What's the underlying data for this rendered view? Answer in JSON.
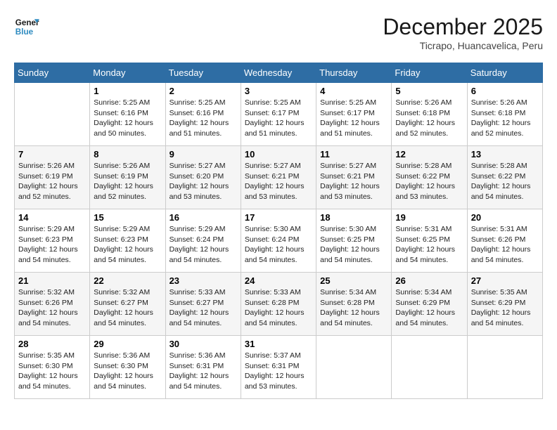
{
  "logo": {
    "line1": "General",
    "line2": "Blue"
  },
  "title": "December 2025",
  "location": "Ticrapo, Huancavelica, Peru",
  "days_header": [
    "Sunday",
    "Monday",
    "Tuesday",
    "Wednesday",
    "Thursday",
    "Friday",
    "Saturday"
  ],
  "weeks": [
    [
      {
        "day": "",
        "sunrise": "",
        "sunset": "",
        "daylight": ""
      },
      {
        "day": "1",
        "sunrise": "Sunrise: 5:25 AM",
        "sunset": "Sunset: 6:16 PM",
        "daylight": "Daylight: 12 hours and 50 minutes."
      },
      {
        "day": "2",
        "sunrise": "Sunrise: 5:25 AM",
        "sunset": "Sunset: 6:16 PM",
        "daylight": "Daylight: 12 hours and 51 minutes."
      },
      {
        "day": "3",
        "sunrise": "Sunrise: 5:25 AM",
        "sunset": "Sunset: 6:17 PM",
        "daylight": "Daylight: 12 hours and 51 minutes."
      },
      {
        "day": "4",
        "sunrise": "Sunrise: 5:25 AM",
        "sunset": "Sunset: 6:17 PM",
        "daylight": "Daylight: 12 hours and 51 minutes."
      },
      {
        "day": "5",
        "sunrise": "Sunrise: 5:26 AM",
        "sunset": "Sunset: 6:18 PM",
        "daylight": "Daylight: 12 hours and 52 minutes."
      },
      {
        "day": "6",
        "sunrise": "Sunrise: 5:26 AM",
        "sunset": "Sunset: 6:18 PM",
        "daylight": "Daylight: 12 hours and 52 minutes."
      }
    ],
    [
      {
        "day": "7",
        "sunrise": "Sunrise: 5:26 AM",
        "sunset": "Sunset: 6:19 PM",
        "daylight": "Daylight: 12 hours and 52 minutes."
      },
      {
        "day": "8",
        "sunrise": "Sunrise: 5:26 AM",
        "sunset": "Sunset: 6:19 PM",
        "daylight": "Daylight: 12 hours and 52 minutes."
      },
      {
        "day": "9",
        "sunrise": "Sunrise: 5:27 AM",
        "sunset": "Sunset: 6:20 PM",
        "daylight": "Daylight: 12 hours and 53 minutes."
      },
      {
        "day": "10",
        "sunrise": "Sunrise: 5:27 AM",
        "sunset": "Sunset: 6:21 PM",
        "daylight": "Daylight: 12 hours and 53 minutes."
      },
      {
        "day": "11",
        "sunrise": "Sunrise: 5:27 AM",
        "sunset": "Sunset: 6:21 PM",
        "daylight": "Daylight: 12 hours and 53 minutes."
      },
      {
        "day": "12",
        "sunrise": "Sunrise: 5:28 AM",
        "sunset": "Sunset: 6:22 PM",
        "daylight": "Daylight: 12 hours and 53 minutes."
      },
      {
        "day": "13",
        "sunrise": "Sunrise: 5:28 AM",
        "sunset": "Sunset: 6:22 PM",
        "daylight": "Daylight: 12 hours and 54 minutes."
      }
    ],
    [
      {
        "day": "14",
        "sunrise": "Sunrise: 5:29 AM",
        "sunset": "Sunset: 6:23 PM",
        "daylight": "Daylight: 12 hours and 54 minutes."
      },
      {
        "day": "15",
        "sunrise": "Sunrise: 5:29 AM",
        "sunset": "Sunset: 6:23 PM",
        "daylight": "Daylight: 12 hours and 54 minutes."
      },
      {
        "day": "16",
        "sunrise": "Sunrise: 5:29 AM",
        "sunset": "Sunset: 6:24 PM",
        "daylight": "Daylight: 12 hours and 54 minutes."
      },
      {
        "day": "17",
        "sunrise": "Sunrise: 5:30 AM",
        "sunset": "Sunset: 6:24 PM",
        "daylight": "Daylight: 12 hours and 54 minutes."
      },
      {
        "day": "18",
        "sunrise": "Sunrise: 5:30 AM",
        "sunset": "Sunset: 6:25 PM",
        "daylight": "Daylight: 12 hours and 54 minutes."
      },
      {
        "day": "19",
        "sunrise": "Sunrise: 5:31 AM",
        "sunset": "Sunset: 6:25 PM",
        "daylight": "Daylight: 12 hours and 54 minutes."
      },
      {
        "day": "20",
        "sunrise": "Sunrise: 5:31 AM",
        "sunset": "Sunset: 6:26 PM",
        "daylight": "Daylight: 12 hours and 54 minutes."
      }
    ],
    [
      {
        "day": "21",
        "sunrise": "Sunrise: 5:32 AM",
        "sunset": "Sunset: 6:26 PM",
        "daylight": "Daylight: 12 hours and 54 minutes."
      },
      {
        "day": "22",
        "sunrise": "Sunrise: 5:32 AM",
        "sunset": "Sunset: 6:27 PM",
        "daylight": "Daylight: 12 hours and 54 minutes."
      },
      {
        "day": "23",
        "sunrise": "Sunrise: 5:33 AM",
        "sunset": "Sunset: 6:27 PM",
        "daylight": "Daylight: 12 hours and 54 minutes."
      },
      {
        "day": "24",
        "sunrise": "Sunrise: 5:33 AM",
        "sunset": "Sunset: 6:28 PM",
        "daylight": "Daylight: 12 hours and 54 minutes."
      },
      {
        "day": "25",
        "sunrise": "Sunrise: 5:34 AM",
        "sunset": "Sunset: 6:28 PM",
        "daylight": "Daylight: 12 hours and 54 minutes."
      },
      {
        "day": "26",
        "sunrise": "Sunrise: 5:34 AM",
        "sunset": "Sunset: 6:29 PM",
        "daylight": "Daylight: 12 hours and 54 minutes."
      },
      {
        "day": "27",
        "sunrise": "Sunrise: 5:35 AM",
        "sunset": "Sunset: 6:29 PM",
        "daylight": "Daylight: 12 hours and 54 minutes."
      }
    ],
    [
      {
        "day": "28",
        "sunrise": "Sunrise: 5:35 AM",
        "sunset": "Sunset: 6:30 PM",
        "daylight": "Daylight: 12 hours and 54 minutes."
      },
      {
        "day": "29",
        "sunrise": "Sunrise: 5:36 AM",
        "sunset": "Sunset: 6:30 PM",
        "daylight": "Daylight: 12 hours and 54 minutes."
      },
      {
        "day": "30",
        "sunrise": "Sunrise: 5:36 AM",
        "sunset": "Sunset: 6:31 PM",
        "daylight": "Daylight: 12 hours and 54 minutes."
      },
      {
        "day": "31",
        "sunrise": "Sunrise: 5:37 AM",
        "sunset": "Sunset: 6:31 PM",
        "daylight": "Daylight: 12 hours and 53 minutes."
      },
      {
        "day": "",
        "sunrise": "",
        "sunset": "",
        "daylight": ""
      },
      {
        "day": "",
        "sunrise": "",
        "sunset": "",
        "daylight": ""
      },
      {
        "day": "",
        "sunrise": "",
        "sunset": "",
        "daylight": ""
      }
    ]
  ]
}
